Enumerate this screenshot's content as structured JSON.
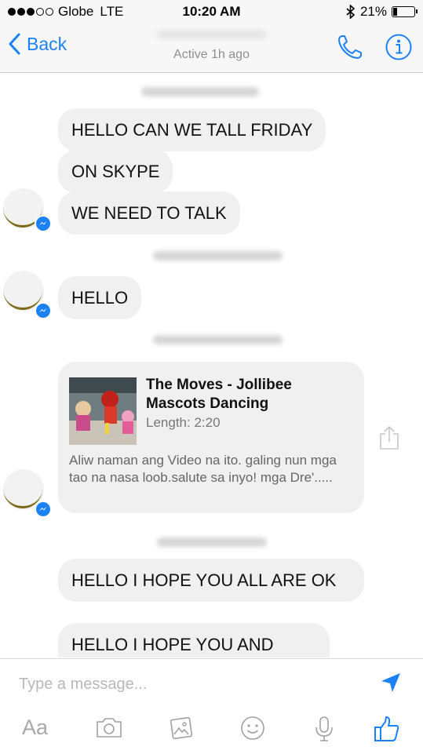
{
  "status_bar": {
    "carrier": "Globe",
    "network": "LTE",
    "time": "10:20 AM",
    "battery": "21%",
    "battery_level": 0.21
  },
  "nav": {
    "back_label": "Back",
    "subtitle": "Active 1h ago"
  },
  "messages": [
    {
      "text": "HELLO        CAN WE TALL  FRIDAY"
    },
    {
      "text": "ON SKYPE"
    },
    {
      "text": "WE NEED TO TALK"
    },
    {
      "text": "HELLO"
    },
    {
      "text": "HELLO          I HOPE YOU ALL ARE OK"
    },
    {
      "text": "HELLO          I HOPE YOU AND"
    }
  ],
  "link_card": {
    "title": "The Moves -  Jollibee Mascots Dancing",
    "length": "Length: 2:20",
    "description": "Aliw naman ang Video na ito. galing nun mga tao na nasa loob.salute sa inyo! mga Dre'....."
  },
  "composer": {
    "placeholder": "Type a message...",
    "text_tool_label": "Aa"
  },
  "colors": {
    "accent": "#1a82f6",
    "bubble": "#f0f0f0",
    "secondary_text": "#8e8e93"
  }
}
